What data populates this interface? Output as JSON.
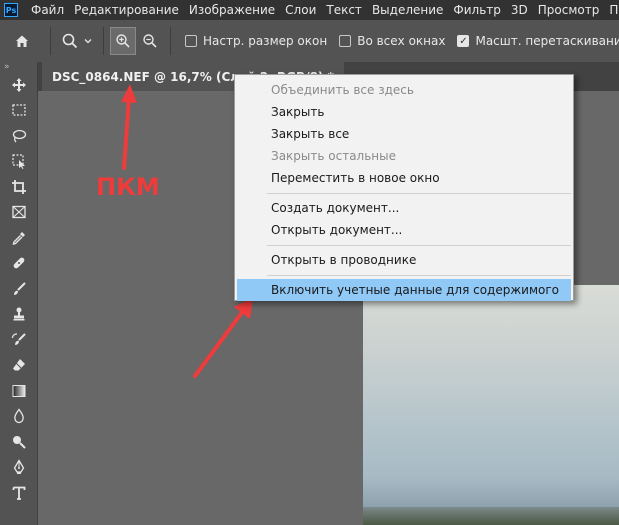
{
  "app": {
    "logo": "Ps"
  },
  "menubar": {
    "items": [
      "Файл",
      "Редактирование",
      "Изображение",
      "Слои",
      "Текст",
      "Выделение",
      "Фильтр",
      "3D",
      "Просмотр",
      "Подключ"
    ]
  },
  "options_bar": {
    "home_icon": "home-icon",
    "zoom_tool_icon": "magnifier-icon",
    "zoom_in_icon": "zoom-in-icon",
    "zoom_out_icon": "zoom-out-icon",
    "resize_windows": {
      "label": "Настр. размер окон",
      "checked": false
    },
    "all_windows": {
      "label": "Во всех окнах",
      "checked": false
    },
    "scrubby_zoom": {
      "label": "Масшт. перетаскиванием",
      "checked": true
    }
  },
  "toolbar": {
    "collapse_glyph": "»",
    "tools": [
      "move-icon",
      "marquee-icon",
      "lasso-icon",
      "object-select-icon",
      "crop-icon",
      "frame-icon",
      "eyedropper-icon",
      "healing-brush-icon",
      "brush-icon",
      "clone-stamp-icon",
      "history-brush-icon",
      "eraser-icon",
      "gradient-icon",
      "blur-icon",
      "dodge-icon",
      "pen-icon",
      "type-icon"
    ]
  },
  "document_tab": {
    "title": "DSC_0864.NEF @ 16,7% (Слой 2, RGB/8) *"
  },
  "annotation": {
    "label": "ПКМ",
    "color": "#ee3b3b"
  },
  "context_menu": {
    "items": [
      {
        "label": "Объединить все здесь",
        "disabled": true
      },
      {
        "label": "Закрыть",
        "disabled": false
      },
      {
        "label": "Закрыть все",
        "disabled": false
      },
      {
        "label": "Закрыть остальные",
        "disabled": true
      },
      {
        "label": "Переместить в новое окно",
        "disabled": false
      },
      {
        "label": "Создать документ...",
        "disabled": false
      },
      {
        "label": "Открыть документ...",
        "disabled": false
      },
      {
        "label": "Открыть в проводнике",
        "disabled": false
      },
      {
        "label": "Включить учетные данные для содержимого",
        "disabled": false,
        "highlighted": true
      }
    ],
    "highlight_color": "#90c8f6"
  }
}
